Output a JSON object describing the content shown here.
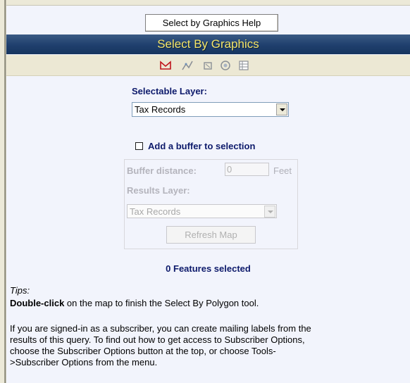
{
  "help_button_label": "Select by Graphics Help",
  "panel_title": "Select By Graphics",
  "toolbar_icons": [
    {
      "name": "polygon-tool-icon"
    },
    {
      "name": "line-tool-icon"
    },
    {
      "name": "rectangle-tool-icon"
    },
    {
      "name": "circle-tool-icon"
    },
    {
      "name": "table-view-icon"
    }
  ],
  "selectable_layer": {
    "label": "Selectable Layer:",
    "selected": "Tax Records"
  },
  "buffer": {
    "checkbox_label": "Add a buffer to selection",
    "checked": false,
    "distance_label": "Buffer distance:",
    "distance_value": "0",
    "distance_unit": "Feet",
    "results_label": "Results Layer:",
    "results_selected": "Tax Records",
    "refresh_label": "Refresh Map"
  },
  "features_selected": "0 Features selected",
  "tips": {
    "heading": "Tips:",
    "double_click_bold": "Double-click",
    "double_click_rest": " on the map to finish the Select By Polygon tool.",
    "subscriber_lines": [
      "If you are signed-in as a subscriber, you can create mailing labels from the",
      "results of this query. To find out how to get access to Subscriber Options,",
      "choose the Subscriber Options button at the top, or choose Tools-",
      ">Subscriber Options from the menu."
    ]
  },
  "colors": {
    "title_bar": "#1f3f6d",
    "title_text": "#f3e56a",
    "label_blue": "#0d1a6b",
    "panel_bg": "#f2f4fc"
  }
}
